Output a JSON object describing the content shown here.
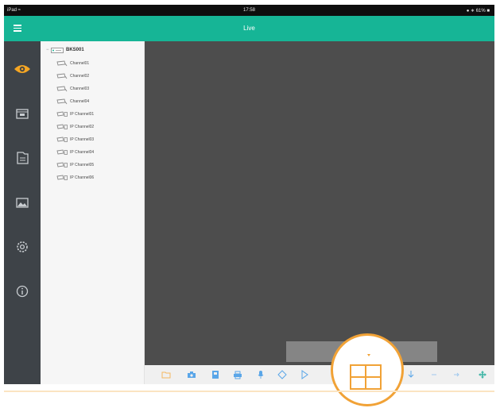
{
  "statusbar": {
    "left": "iPad ≈",
    "time": "17:58",
    "right": "● ∗ 61% ■"
  },
  "appbar": {
    "title": "Live",
    "menu_icon": "hamburger-icon"
  },
  "colors": {
    "accent": "#16b596",
    "sidebar": "#3e4348",
    "active": "#f5a623",
    "highlight": "#f1a236",
    "viewer": "#4d4d4d",
    "toolbar_icon": "#5aa6e8"
  },
  "sidebar": {
    "items": [
      {
        "name": "live-view",
        "icon": "eye-icon",
        "active": true
      },
      {
        "name": "playback",
        "icon": "playback-icon",
        "active": false
      },
      {
        "name": "files",
        "icon": "folder-icon",
        "active": false
      },
      {
        "name": "images",
        "icon": "image-icon",
        "active": false
      },
      {
        "name": "settings",
        "icon": "gear-icon",
        "active": false
      },
      {
        "name": "info",
        "icon": "info-icon",
        "active": false
      }
    ]
  },
  "tree": {
    "root": {
      "label": "BKS001",
      "icon": "dvr-icon"
    },
    "channels": [
      {
        "label": "Channel01",
        "icon": "camera-icon"
      },
      {
        "label": "Channel02",
        "icon": "camera-icon"
      },
      {
        "label": "Channel03",
        "icon": "camera-icon"
      },
      {
        "label": "Channel04",
        "icon": "camera-icon"
      },
      {
        "label": "IP Channel01",
        "icon": "ip-camera-icon"
      },
      {
        "label": "IP Channel02",
        "icon": "ip-camera-icon"
      },
      {
        "label": "IP Channel03",
        "icon": "ip-camera-icon"
      },
      {
        "label": "IP Channel04",
        "icon": "ip-camera-icon"
      },
      {
        "label": "IP Channel05",
        "icon": "ip-camera-icon"
      },
      {
        "label": "IP Channel06",
        "icon": "ip-camera-icon"
      }
    ]
  },
  "toolbar": {
    "tools": [
      {
        "name": "folder",
        "icon": "folder-icon"
      },
      {
        "name": "capture",
        "icon": "camera-icon"
      },
      {
        "name": "record",
        "icon": "record-icon"
      },
      {
        "name": "print",
        "icon": "print-icon"
      },
      {
        "name": "microphone",
        "icon": "microphone-icon"
      },
      {
        "name": "ptz",
        "icon": "ptz-icon"
      },
      {
        "name": "play",
        "icon": "play-icon"
      },
      {
        "name": "download",
        "icon": "download-icon"
      },
      {
        "name": "prev",
        "icon": "chevron-left-icon"
      },
      {
        "name": "next",
        "icon": "chevron-right-icon"
      },
      {
        "name": "directional",
        "icon": "move-icon"
      }
    ],
    "highlighted": {
      "name": "split-screen-layout",
      "icon": "grid-layout-icon"
    }
  }
}
